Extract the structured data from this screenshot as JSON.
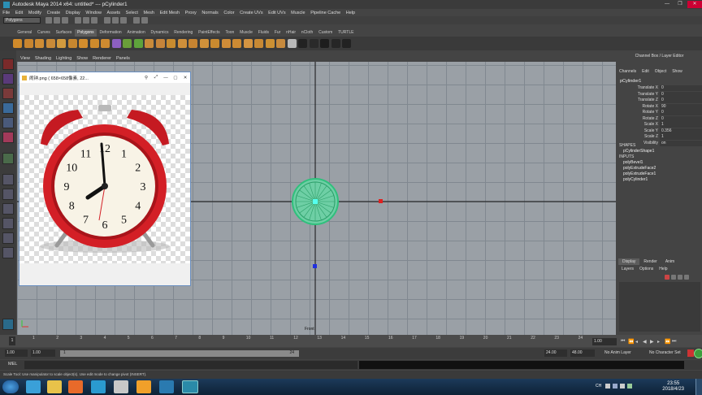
{
  "window": {
    "title": "Autodesk Maya 2014 x64: untitled*   ---   pCylinder1",
    "min": "—",
    "max": "❐",
    "close": "✕"
  },
  "menubar": [
    "File",
    "Edit",
    "Modify",
    "Create",
    "Display",
    "Window",
    "Assets",
    "Select",
    "Mesh",
    "Edit Mesh",
    "Proxy",
    "Normals",
    "Color",
    "Create UVs",
    "Edit UVs",
    "Muscle",
    "Pipeline Cache",
    "Help"
  ],
  "mode_select": "Polygons",
  "shelf_tabs": [
    "General",
    "Curves",
    "Surfaces",
    "Polygons",
    "Deformation",
    "Animation",
    "Dynamics",
    "Rendering",
    "PaintEffects",
    "Toon",
    "Muscle",
    "Fluids",
    "Fur",
    "nHair",
    "nCloth",
    "Custom",
    "TURTLE"
  ],
  "shelf_active": "Polygons",
  "viewport": {
    "menu": [
      "View",
      "Shading",
      "Lighting",
      "Show",
      "Renderer",
      "Panels"
    ],
    "camera_label": "Front"
  },
  "image_viewer": {
    "title": "闹钟.png ( 658×658像素, 22...",
    "clock_numbers": [
      "12",
      "1",
      "2",
      "3",
      "4",
      "5",
      "6",
      "7",
      "8",
      "9",
      "10",
      "11"
    ]
  },
  "channel_box": {
    "title": "Channel Box / Layer Editor",
    "menu": [
      "Channels",
      "Edit",
      "Object",
      "Show"
    ],
    "node": "pCylinder1",
    "attributes": [
      {
        "label": "Translate X",
        "value": "0"
      },
      {
        "label": "Translate Y",
        "value": "0"
      },
      {
        "label": "Translate Z",
        "value": "0"
      },
      {
        "label": "Rotate X",
        "value": "90"
      },
      {
        "label": "Rotate Y",
        "value": "0"
      },
      {
        "label": "Rotate Z",
        "value": "0"
      },
      {
        "label": "Scale X",
        "value": "1"
      },
      {
        "label": "Scale Y",
        "value": "0.356"
      },
      {
        "label": "Scale Z",
        "value": "1"
      },
      {
        "label": "Visibility",
        "value": "on"
      }
    ],
    "shapes_header": "SHAPES",
    "shape": "pCylinderShape1",
    "inputs_header": "INPUTS",
    "inputs": [
      "polyBevel1",
      "polyExtrudeFace2",
      "polyExtrudeFace1",
      "polyCylinder1"
    ]
  },
  "layer_editor": {
    "tabs": [
      "Display",
      "Render",
      "Anim"
    ],
    "active_tab": "Display",
    "menu": [
      "Layers",
      "Options",
      "Help"
    ]
  },
  "time_slider": {
    "ticks": [
      "1",
      "2",
      "3",
      "4",
      "5",
      "6",
      "7",
      "8",
      "9",
      "10",
      "11",
      "12",
      "13",
      "14",
      "15",
      "16",
      "17",
      "18",
      "19",
      "20",
      "21",
      "22",
      "23",
      "24"
    ],
    "current": "1",
    "current_field": "1.00"
  },
  "range_slider": {
    "start": "1.00",
    "start_inner": "1.00",
    "range_start": "1",
    "range_end": "24",
    "end_inner": "24.00",
    "end": "48.00",
    "anim_layer": "No Anim Layer",
    "character_set": "No Character Set"
  },
  "command_line": {
    "label": "MEL"
  },
  "help_line": "Scale Tool: Use manipulator to scale object(s). Use edit mode to change pivot (INSERT).",
  "taskbar": {
    "time": "23:55",
    "date": "2018/4/23",
    "lang": "CH"
  },
  "colors": {
    "clock_red": "#d31f26",
    "cylinder_green": "#3ad48c",
    "maya_gray": "#444444"
  }
}
